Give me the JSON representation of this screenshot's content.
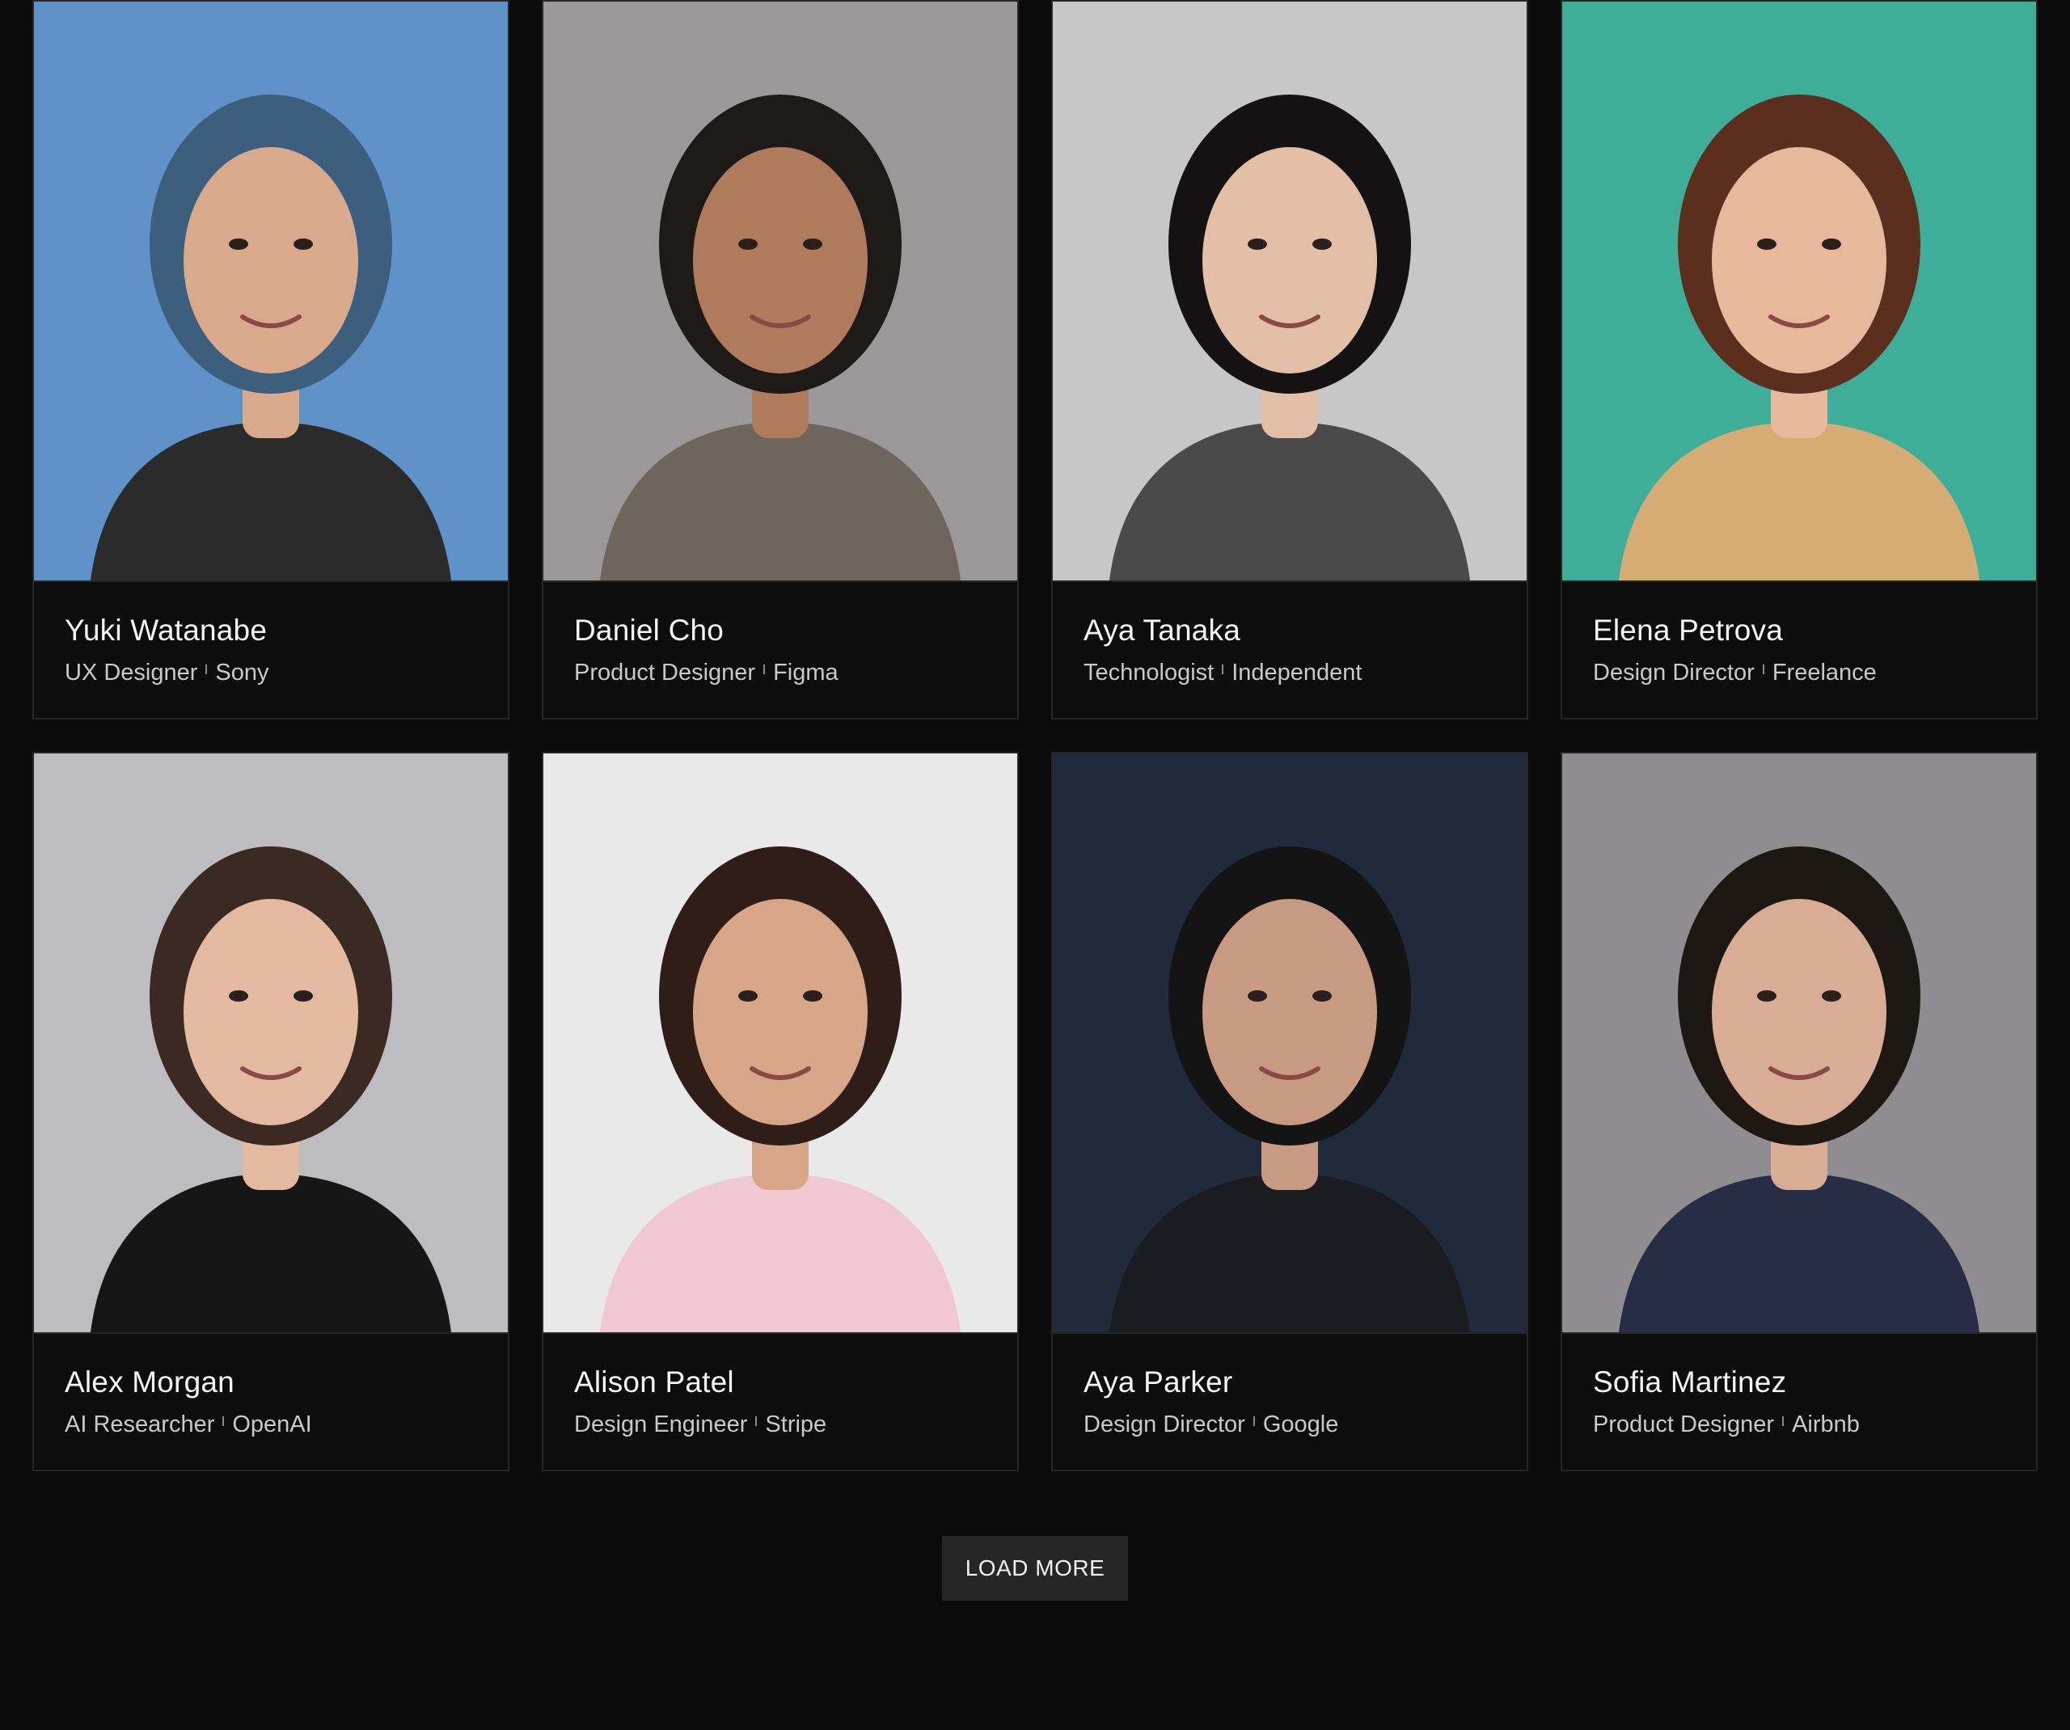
{
  "people": [
    {
      "name": "Yuki Watanabe",
      "role": "UX Designer",
      "company": "Sony",
      "bg": "#5f93c8",
      "skin": "#d9a98c",
      "hair": "#3c5f7e",
      "cloth": "#2b2b2b"
    },
    {
      "name": "Daniel Cho",
      "role": "Product Designer",
      "company": "Figma",
      "bg": "#9a9898",
      "skin": "#b07b5c",
      "hair": "#1e1a18",
      "cloth": "#6e665c"
    },
    {
      "name": "Aya Tanaka",
      "role": "Technologist",
      "company": "Independent",
      "bg": "#c7c7c7",
      "skin": "#e2bfa6",
      "hair": "#141212",
      "cloth": "#4a4a4a"
    },
    {
      "name": "Elena Petrova",
      "role": "Design Director",
      "company": "Freelance",
      "bg": "#3fae98",
      "skin": "#e7b89c",
      "hair": "#5b2e1e",
      "cloth": "#d6ac74"
    },
    {
      "name": "Alex Morgan",
      "role": "AI Researcher",
      "company": "OpenAI",
      "bg": "#bdbdbf",
      "skin": "#e4b9a1",
      "hair": "#3a2a22",
      "cloth": "#161616"
    },
    {
      "name": "Alison Patel",
      "role": "Design Engineer",
      "company": "Stripe",
      "bg": "#e9e9ea",
      "skin": "#d7a688",
      "hair": "#2e1e17",
      "cloth": "#efc8d2"
    },
    {
      "name": "Aya Parker",
      "role": "Design Director",
      "company": "Google",
      "bg": "#1f2a3a",
      "skin": "#c99a82",
      "hair": "#141414",
      "cloth": "#1a1c22"
    },
    {
      "name": "Sofia Martinez",
      "role": "Product Designer",
      "company": "Airbnb",
      "bg": "#8f8d90",
      "skin": "#d9ad95",
      "hair": "#1f1712",
      "cloth": "#262d45"
    }
  ],
  "load_more_label": "LOAD MORE"
}
